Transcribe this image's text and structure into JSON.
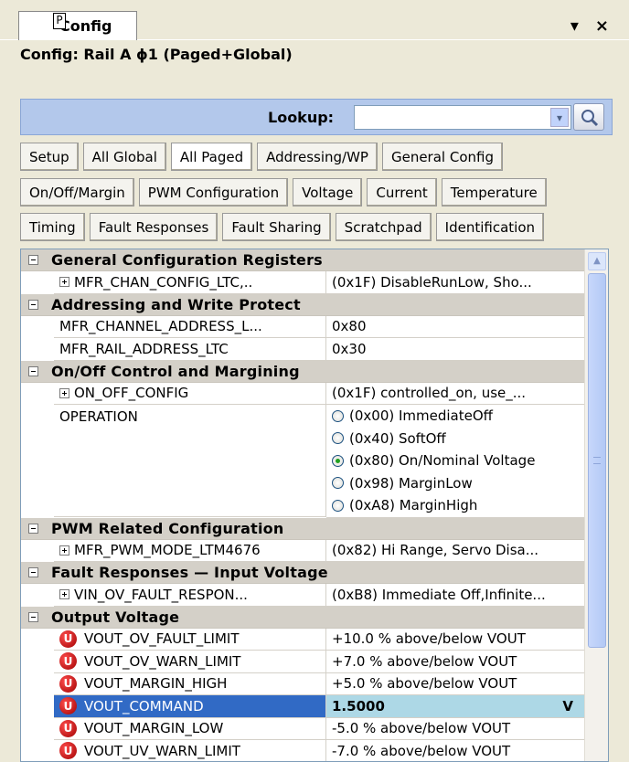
{
  "panel": {
    "tab_label": "Config",
    "tab_icon_glyph": "P",
    "pin_glyph": "▾",
    "close_glyph": "×",
    "title": "Config: Rail A ɸ1 (Paged+Global)"
  },
  "lookup": {
    "label": "Lookup:",
    "value": "",
    "dropdown_glyph": "▾"
  },
  "buttons": {
    "row1": [
      "Setup",
      "All Global",
      "All Paged",
      "Addressing/WP",
      "General Config"
    ],
    "row2": [
      "On/Off/Margin",
      "PWM Configuration",
      "Voltage",
      "Current",
      "Temperature"
    ],
    "row3": [
      "Timing",
      "Fault Responses",
      "Fault Sharing",
      "Scratchpad",
      "Identification"
    ],
    "active": "All Paged"
  },
  "grid": {
    "cat_general": "General Configuration Registers",
    "mfr_chan_name": "MFR_CHAN_CONFIG_LTC,..",
    "mfr_chan_val": "(0x1F)  DisableRunLow, Sho...",
    "cat_addr": "Addressing and Write Protect",
    "chan_addr_name": "MFR_CHANNEL_ADDRESS_L...",
    "chan_addr_val": "0x80",
    "rail_addr_name": "MFR_RAIL_ADDRESS_LTC",
    "rail_addr_val": "0x30",
    "cat_onoff": "On/Off Control and Margining",
    "onoff_name": "ON_OFF_CONFIG",
    "onoff_val": "(0x1F)  controlled_on, use_...",
    "operation_name": "OPERATION",
    "operation_opts": [
      "(0x00) ImmediateOff",
      "(0x40) SoftOff",
      "(0x80) On/Nominal Voltage",
      "(0x98) MarginLow",
      "(0xA8) MarginHigh"
    ],
    "operation_selected": "(0x80) On/Nominal Voltage",
    "cat_pwm": "PWM Related Configuration",
    "pwm_name": "MFR_PWM_MODE_LTM4676",
    "pwm_val": "(0x82) Hi Range, Servo Disa...",
    "cat_fault": "Fault Responses — Input Voltage",
    "vin_ov_name": "VIN_OV_FAULT_RESPON...",
    "vin_ov_val": "(0xB8) Immediate Off,Infinite...",
    "cat_vout": "Output Voltage",
    "u_glyph": "U",
    "vout_rows": [
      {
        "name": "VOUT_OV_FAULT_LIMIT",
        "value": "+10.0 % above/below VOUT"
      },
      {
        "name": "VOUT_OV_WARN_LIMIT",
        "value": "+7.0 % above/below VOUT"
      },
      {
        "name": "VOUT_MARGIN_HIGH",
        "value": "+5.0 % above/below VOUT"
      },
      {
        "name": "VOUT_COMMAND",
        "value": "1.5000",
        "unit": "V"
      },
      {
        "name": "VOUT_MARGIN_LOW",
        "value": "-5.0 % above/below VOUT"
      },
      {
        "name": "VOUT_UV_WARN_LIMIT",
        "value": "-7.0 % above/below VOUT"
      }
    ]
  },
  "colors": {
    "lookup_bar": "#b3c8eb",
    "selected_name_bg": "#316ac5",
    "selected_value_bg": "#add8e6",
    "category_bg": "#d4d0c8",
    "u_icon": "#d00000"
  },
  "icons": {
    "search": "magnifier-icon",
    "unit": "red-u-icon"
  }
}
